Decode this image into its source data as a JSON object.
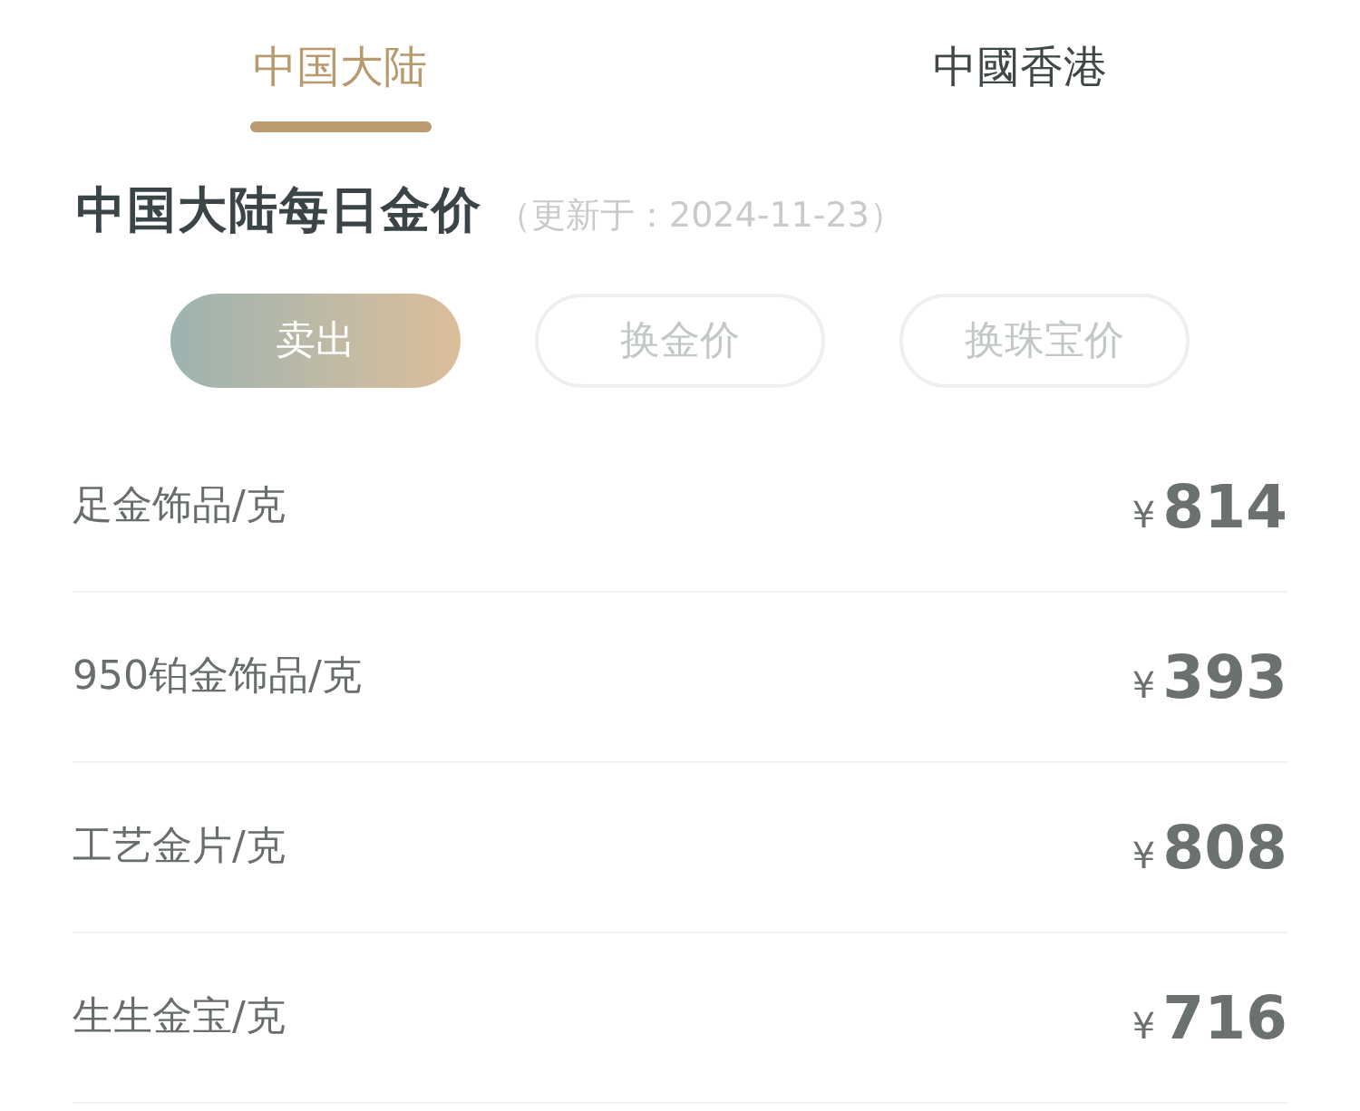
{
  "region_tabs": [
    {
      "label": "中国大陆",
      "selected": true
    },
    {
      "label": "中國香港",
      "selected": false
    }
  ],
  "heading": {
    "title": "中国大陆每日金价",
    "updated": "（更新于：2024-11-23）"
  },
  "price_types": [
    {
      "label": "卖出",
      "selected": true
    },
    {
      "label": "换金价",
      "selected": false
    },
    {
      "label": "换珠宝价",
      "selected": false
    }
  ],
  "prices": [
    {
      "name": "足金饰品/克",
      "currency": "¥",
      "amount": "814"
    },
    {
      "name": "950铂金饰品/克",
      "currency": "¥",
      "amount": "393"
    },
    {
      "name": "工艺金片/克",
      "currency": "¥",
      "amount": "808"
    },
    {
      "name": "生生金宝/克",
      "currency": "¥",
      "amount": "716"
    }
  ]
}
